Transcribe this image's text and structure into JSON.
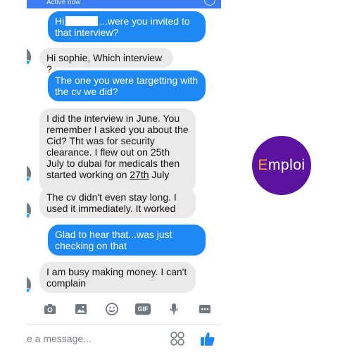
{
  "header": {
    "status": "Active now"
  },
  "messages": [
    {
      "dir": "out",
      "pre": "Hi",
      "post": "...were you invited to",
      "line2": "that interview?"
    },
    {
      "dir": "in",
      "text": "Hi sophie, Which interview ?"
    },
    {
      "dir": "out",
      "lines": [
        "The one you were targetting with",
        "the cv we did?"
      ]
    },
    {
      "dir": "in",
      "lines": [
        "I did the interview in June. You",
        "remember I asked you about the",
        "Cid? Tht was for security",
        "clearance. I flew out on 25th",
        "July to dubai for medicals then"
      ],
      "last_pre": "started working on ",
      "last_u": "27th",
      "last_post": " July"
    },
    {
      "dir": "in",
      "lines": [
        "The cv didn't even stay long. I",
        "used it immediately. It worked"
      ]
    },
    {
      "dir": "out",
      "lines": [
        "Glad to hear that...was just",
        "checking on that"
      ]
    },
    {
      "dir": "in",
      "lines": [
        "I am busy making money. I can't",
        "complain"
      ]
    }
  ],
  "toolbar": {
    "icons": [
      "camera-icon",
      "image-icon",
      "emoji-icon",
      "gif-icon",
      "microphone-icon",
      "more-icon"
    ],
    "gif_label": "GIF"
  },
  "composer": {
    "placeholder": "e a message..."
  },
  "brand": {
    "e": "E",
    "rest": "mploi"
  },
  "colors": {
    "header": "#3b7df0",
    "outgoing": "#1e88f5",
    "incoming": "#eaeaea",
    "logo_bg": "#5b139e",
    "logo_accent": "#ff9a2e"
  }
}
